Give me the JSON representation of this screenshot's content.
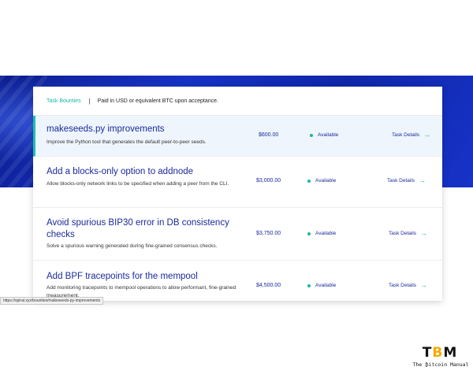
{
  "header": {
    "tab_label": "Task Bounties",
    "separator": "|",
    "note": "Paid in USD or equivalent BTC upon acceptance."
  },
  "tasks": [
    {
      "title": "makeseeds.py improvements",
      "description": "Improve the Python tool that generates the default peer-to-peer seeds.",
      "price": "$600.00",
      "status": "Available",
      "details_label": "Task Details"
    },
    {
      "title": "Add a blocks-only option to addnode",
      "description": "Allow blocks-only network links to be specified when adding a peer from the CLI.",
      "price": "$3,000.00",
      "status": "Available",
      "details_label": "Task Details"
    },
    {
      "title": "Avoid spurious BIP30 error in DB consistency checks",
      "description": "Solve a spurious warning generated during fine-grained consensus checks.",
      "price": "$3,750.00",
      "status": "Available",
      "details_label": "Task Details"
    },
    {
      "title": "Add BPF tracepoints for the mempool",
      "description": "Add monitoring tracepoints to mempool operations to allow performant, fine-grained measurement.",
      "price": "$4,500.00",
      "status": "Available",
      "details_label": "Task Details"
    }
  ],
  "status_bar": {
    "url": "https://spiral.xyz/bounties/makeseeds-py-improvements"
  },
  "watermark": {
    "mark_prefix": "T",
    "mark_accent": "B",
    "mark_suffix": "M",
    "name": "The ₿itcoin Manual"
  },
  "colors": {
    "brand_blue": "#1a2a9c",
    "accent_teal": "#19c2b0",
    "hero_blue": "#1631c4",
    "bitcoin_orange": "#f2a900"
  },
  "icons": {
    "status": "status-dot-icon",
    "details": "arrow-right-icon"
  }
}
